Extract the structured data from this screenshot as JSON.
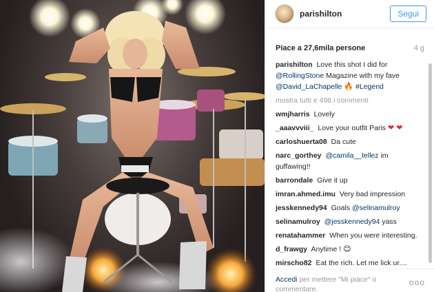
{
  "post": {
    "username": "parishilton",
    "follow_label": "Segui",
    "likes_text": "Piace a 27,6mila persone",
    "age": "4 g",
    "caption": {
      "user": "parishilton",
      "text1": "Love this shot I did for",
      "mention1": "@RollingStone",
      "text2": "Magazine with my fave",
      "mention2": "@David_LaChapelle",
      "emoji": "🔥",
      "hashtag": "#Legend"
    },
    "more_comments": "mostra tutti e 498 i commenti",
    "comments": [
      {
        "user": "wmjharris",
        "text": "Lovely"
      },
      {
        "user": "_aaavvviii_",
        "text": "Love your outfit Paris",
        "hearts": "❤ ❤"
      },
      {
        "user": "carloshuerta08",
        "text": "Da cute"
      },
      {
        "user": "narc_gorthey",
        "mention": "@camila__tellez",
        "text": "im guffawing!!"
      },
      {
        "user": "barrondale",
        "text": "Give it up"
      },
      {
        "user": "imran.ahmed.imu",
        "text": "Very bad impression"
      },
      {
        "user": "jesskennedy94",
        "text": "Goals",
        "mention": "@selinamulroy"
      },
      {
        "user": "selinamulroy",
        "mention": "@jesskennedy94",
        "text": "yass"
      },
      {
        "user": "renatahammer",
        "text": "When you were interesting."
      },
      {
        "user": "d_frawgy",
        "text": "Anytime !",
        "emoji": "😊"
      },
      {
        "user": "mirscho82",
        "text": "Eat the rich. Let me lick ur...."
      }
    ],
    "footer": {
      "login_link": "Accedi",
      "login_text": "per mettere \"Mi piace\" o commentare.",
      "options": "ooo"
    }
  }
}
